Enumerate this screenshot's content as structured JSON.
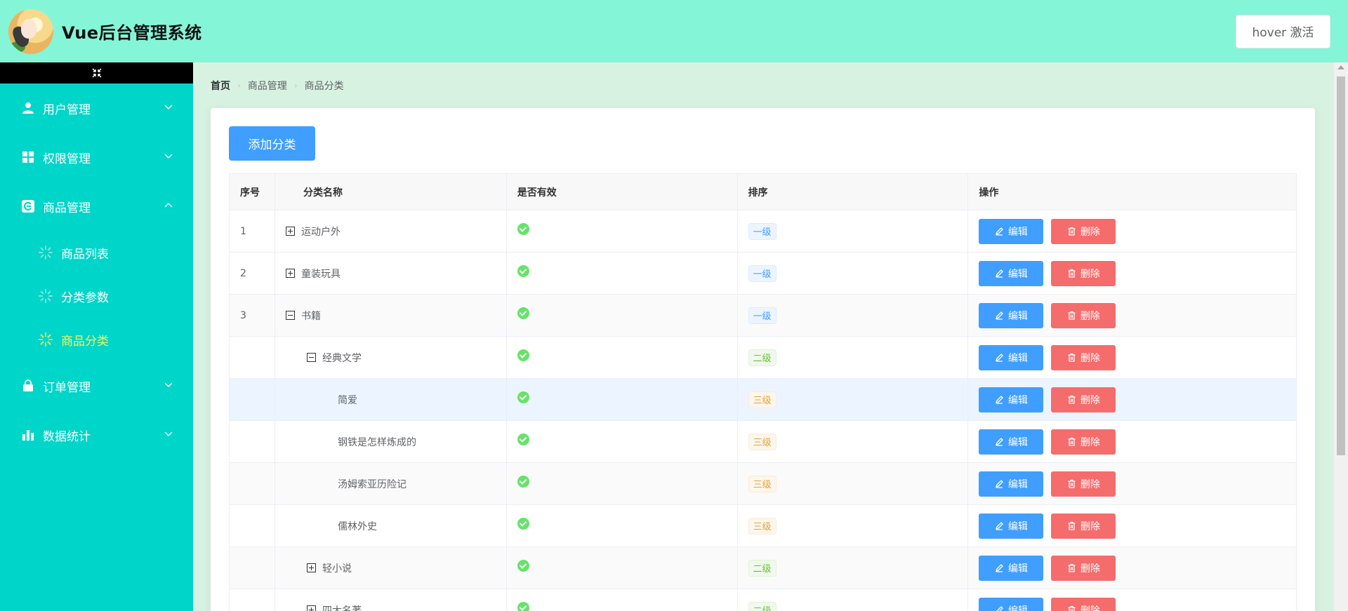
{
  "header": {
    "title": "Vue后台管理系统",
    "hover_button": "hover 激活"
  },
  "sidebar": {
    "collapse_icon": "collapse-arrows-icon",
    "menus": [
      {
        "label": "用户管理",
        "icon": "user-icon",
        "expanded": false
      },
      {
        "label": "权限管理",
        "icon": "grid-icon",
        "expanded": false
      },
      {
        "label": "商品管理",
        "icon": "goods-icon",
        "expanded": true,
        "children": [
          {
            "label": "商品列表",
            "active": false
          },
          {
            "label": "分类参数",
            "active": false
          },
          {
            "label": "商品分类",
            "active": true
          }
        ]
      },
      {
        "label": "订单管理",
        "icon": "bag-icon",
        "expanded": false
      },
      {
        "label": "数据统计",
        "icon": "bar-chart-icon",
        "expanded": false
      }
    ]
  },
  "breadcrumb": [
    "首页",
    "商品管理",
    "商品分类"
  ],
  "add_button": "添加分类",
  "table": {
    "headers": [
      "序号",
      "分类名称",
      "是否有效",
      "排序",
      "操作"
    ],
    "edit_label": "编辑",
    "delete_label": "删除",
    "rows": [
      {
        "index": "1",
        "name": "运动户外",
        "level": "一级",
        "indent": 0,
        "expand": "plus"
      },
      {
        "index": "2",
        "name": "童装玩具",
        "level": "一级",
        "indent": 0,
        "expand": "plus"
      },
      {
        "index": "3",
        "name": "书籍",
        "level": "一级",
        "indent": 0,
        "expand": "minus"
      },
      {
        "index": "",
        "name": "经典文学",
        "level": "二级",
        "indent": 1,
        "expand": "minus"
      },
      {
        "index": "",
        "name": "简爱",
        "level": "三级",
        "indent": 2,
        "expand": ""
      },
      {
        "index": "",
        "name": "钢铁是怎样炼成的",
        "level": "三级",
        "indent": 2,
        "expand": ""
      },
      {
        "index": "",
        "name": "汤姆索亚历险记",
        "level": "三级",
        "indent": 2,
        "expand": ""
      },
      {
        "index": "",
        "name": "儒林外史",
        "level": "三级",
        "indent": 2,
        "expand": ""
      },
      {
        "index": "",
        "name": "轻小说",
        "level": "二级",
        "indent": 1,
        "expand": "plus"
      },
      {
        "index": "",
        "name": "四大名著",
        "level": "二级",
        "indent": 1,
        "expand": "plus"
      }
    ]
  },
  "colors": {
    "header_bg": "#85f5d8",
    "sidebar_bg": "#00d5c9",
    "primary": "#409eff",
    "danger": "#f56c6c",
    "active_text": "#f4f65a"
  }
}
